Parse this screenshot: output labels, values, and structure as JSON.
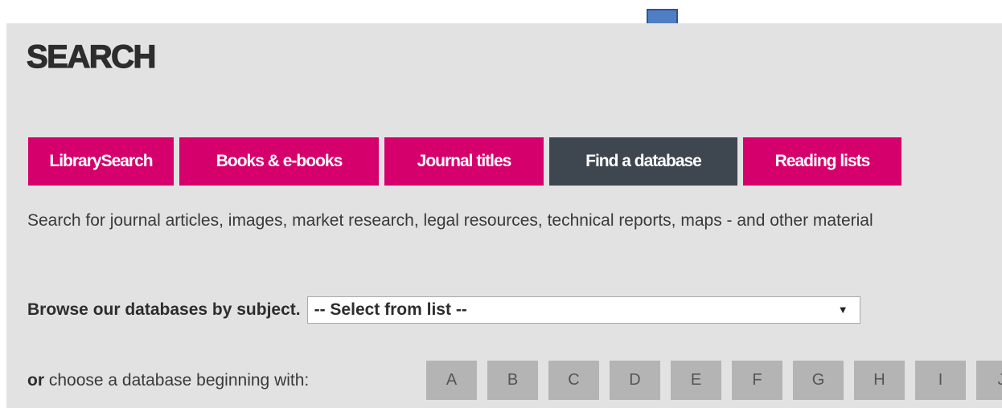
{
  "page": {
    "title": "SEARCH",
    "tabs": [
      {
        "label": "LibrarySearch",
        "active": false
      },
      {
        "label": "Books & e-books",
        "active": false
      },
      {
        "label": "Journal titles",
        "active": false
      },
      {
        "label": "Find a database",
        "active": true
      },
      {
        "label": "Reading lists",
        "active": false
      }
    ],
    "description": "Search for journal articles, images, market research, legal resources, technical reports, maps - and other material",
    "browse": {
      "label": "Browse our databases by subject.",
      "selected": "-- Select from list --",
      "arrow": "▼"
    },
    "az": {
      "label_bold": "or",
      "label_rest": " choose a database beginning with:",
      "letters": [
        "A",
        "B",
        "C",
        "D",
        "E",
        "F",
        "G",
        "H",
        "I",
        "J"
      ]
    }
  },
  "colors": {
    "tab": "#d6006d",
    "tab_active": "#3e4650",
    "arrow_fill": "#4f7ec4",
    "arrow_stroke": "#2e5597",
    "panel": "#e2e2e2"
  },
  "annotation": {
    "icon": "arrow-down-icon"
  }
}
